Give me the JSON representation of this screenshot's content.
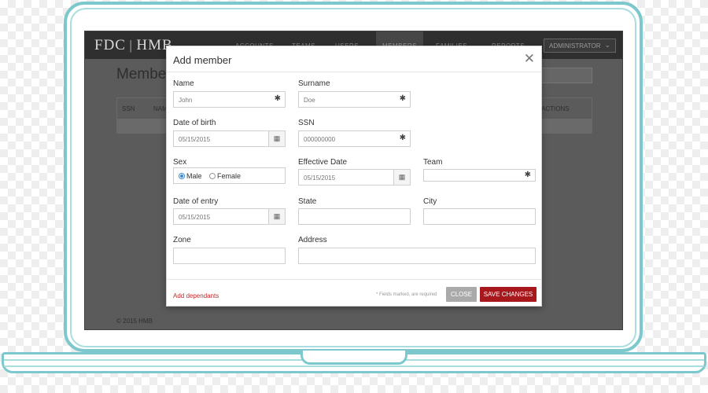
{
  "app": {
    "logo_primary": "FDC",
    "logo_secondary": "HMB",
    "nav": [
      "ACCOUNTS",
      "TEAMS",
      "USERS",
      "MEMBERS",
      "FAMILIES",
      "REPORTS"
    ],
    "role_select": "ADMINISTRATOR",
    "page_title": "Members",
    "table_headers": [
      "SSN",
      "NAME",
      "ACTIONS"
    ],
    "footer": "© 2015 HMB"
  },
  "modal": {
    "title": "Add member",
    "fields": {
      "name": {
        "label": "Name",
        "value": "John"
      },
      "surname": {
        "label": "Surname",
        "value": "Doe"
      },
      "dob": {
        "label": "Date of birth",
        "value": "05/15/2015"
      },
      "ssn": {
        "label": "SSN",
        "value": "000000000"
      },
      "sex": {
        "label": "Sex",
        "options": [
          "Male",
          "Female"
        ],
        "selected": "Male"
      },
      "effective_date": {
        "label": "Effective Date",
        "value": "05/15/2015"
      },
      "team": {
        "label": "Team",
        "value": ""
      },
      "date_of_entry": {
        "label": "Date of entry",
        "value": "05/15/2015"
      },
      "state": {
        "label": "State",
        "value": ""
      },
      "city": {
        "label": "City",
        "value": ""
      },
      "zone": {
        "label": "Zone",
        "value": ""
      },
      "address": {
        "label": "Address",
        "value": ""
      }
    },
    "add_dependants": "Add dependants",
    "required_note": "* Fields marked, are required",
    "close_label": "CLOSE",
    "save_label": "SAVE CHANGES",
    "required_marker": "✱",
    "calendar_icon": "calendar-icon"
  },
  "colors": {
    "accent_red": "#a8171c",
    "radio_blue": "#3b8ed6",
    "laptop_outline": "#7cc8cc"
  }
}
